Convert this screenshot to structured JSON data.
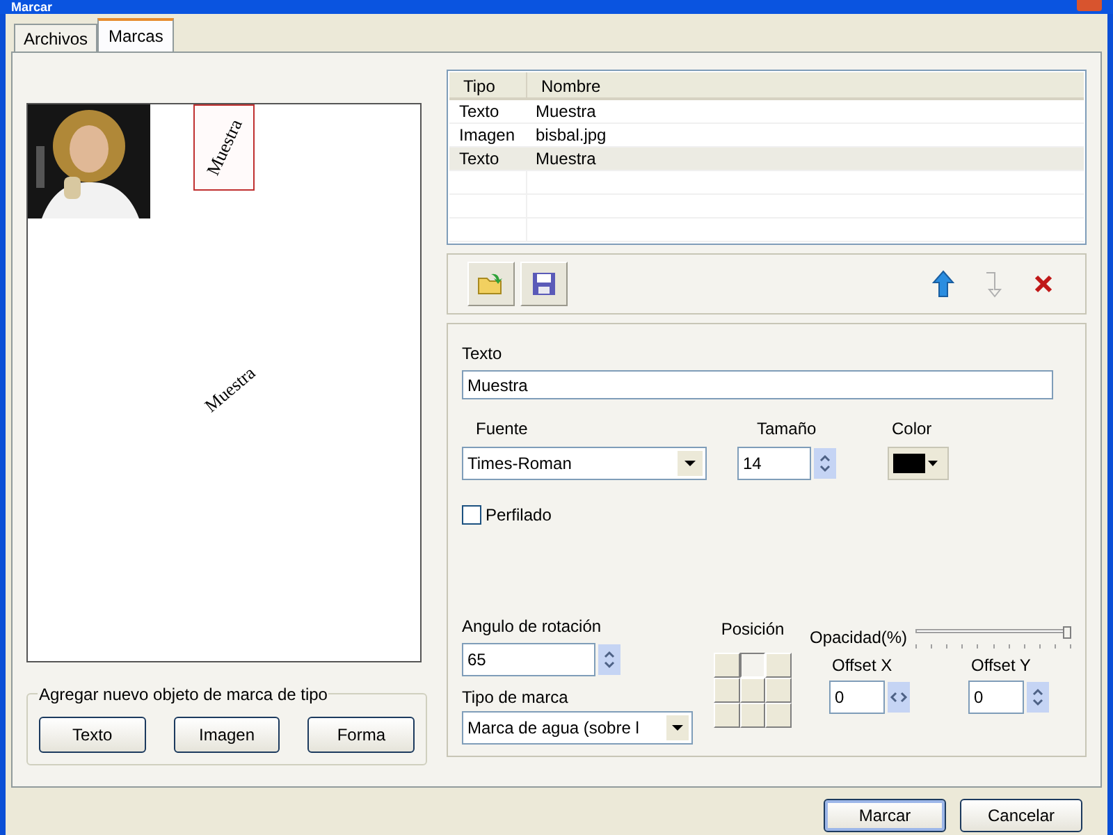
{
  "window": {
    "title": "Marcar"
  },
  "tabs": [
    {
      "label": "Archivos",
      "selected": false
    },
    {
      "label": "Marcas",
      "selected": true
    }
  ],
  "preview": {
    "marks": [
      {
        "kind": "picture"
      },
      {
        "kind": "text",
        "text": "Muestra",
        "selected": true
      },
      {
        "kind": "text",
        "text": "Muestra",
        "selected": false
      }
    ]
  },
  "add_group": {
    "legend": "Agregar nuevo objeto de marca de tipo",
    "buttons": [
      "Texto",
      "Imagen",
      "Forma"
    ]
  },
  "list": {
    "columns": [
      "Tipo",
      "Nombre"
    ],
    "rows": [
      {
        "tipo": "Texto",
        "nombre": "Muestra",
        "selected": false
      },
      {
        "tipo": "Imagen",
        "nombre": "bisbal.jpg",
        "selected": false
      },
      {
        "tipo": "Texto",
        "nombre": "Muestra",
        "selected": true
      }
    ]
  },
  "toolbar": [
    {
      "kind": "open",
      "disabled": false
    },
    {
      "kind": "save",
      "disabled": false
    },
    {
      "kind": "up",
      "disabled": false
    },
    {
      "kind": "down",
      "disabled": true
    },
    {
      "kind": "delete",
      "disabled": false
    }
  ],
  "properties": {
    "text_label": "Texto",
    "text_value": "Muestra",
    "font_label": "Fuente",
    "font_value": "Times-Roman",
    "size_label": "Tamaño",
    "size_value": "14",
    "color_label": "Color",
    "color": "#000000",
    "outline": {
      "label": "Perfilado",
      "checked": false
    },
    "angle_label": "Angulo de rotación",
    "angle_value": "65",
    "type_label": "Tipo de marca",
    "type_value": "Marca de agua (sobre l",
    "position_label": "Posición",
    "positions": [
      {
        "selected": false
      },
      {
        "selected": true
      },
      {
        "selected": false
      },
      {
        "selected": false
      },
      {
        "selected": false
      },
      {
        "selected": false
      },
      {
        "selected": false
      },
      {
        "selected": false
      },
      {
        "selected": false
      }
    ],
    "opacity": {
      "label": "Opacidad(%)",
      "level": 1
    },
    "offset_x_label": "Offset X",
    "offset_x_value": "0",
    "offset_y_label": "Offset Y",
    "offset_y_value": "0"
  },
  "footer_buttons": [
    {
      "label": "Marcar",
      "default": true
    },
    {
      "label": "Cancelar",
      "default": false
    }
  ]
}
